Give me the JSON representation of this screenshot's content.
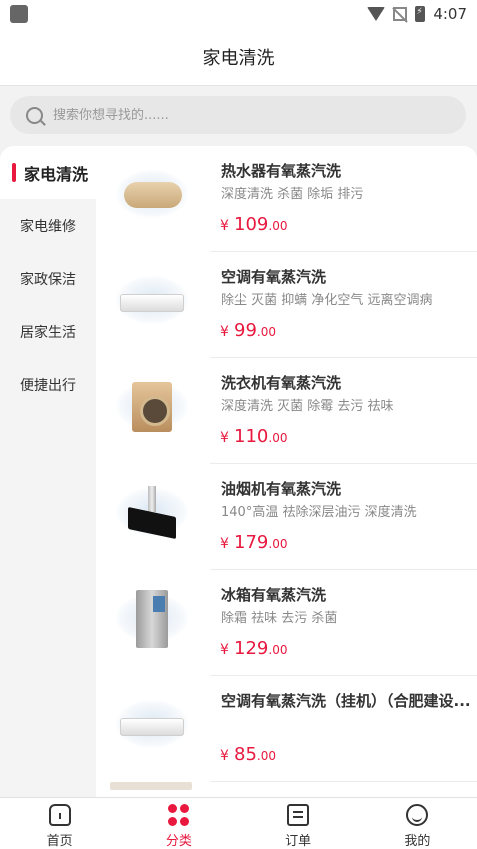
{
  "status_bar": {
    "time": "4:07"
  },
  "header": {
    "title": "家电清洗"
  },
  "search": {
    "placeholder": "搜索你想寻找的......"
  },
  "sidebar": {
    "items": [
      {
        "label": "家电清洗",
        "active": true
      },
      {
        "label": "家电维修",
        "active": false
      },
      {
        "label": "家政保洁",
        "active": false
      },
      {
        "label": "居家生活",
        "active": false
      },
      {
        "label": "便捷出行",
        "active": false
      }
    ]
  },
  "products": [
    {
      "title": "热水器有氧蒸汽洗",
      "subtitle": "深度清洗 杀菌 除垢 排污",
      "currency": "¥",
      "price_int": "109",
      "price_dec": ".00",
      "image": "water-heater"
    },
    {
      "title": "空调有氧蒸汽洗",
      "subtitle": "除尘 灭菌 抑螨 净化空气 远离空调病",
      "currency": "¥",
      "price_int": "99",
      "price_dec": ".00",
      "image": "air-conditioner"
    },
    {
      "title": "洗衣机有氧蒸汽洗",
      "subtitle": "深度清洗 灭菌 除霉 去污 祛味",
      "currency": "¥",
      "price_int": "110",
      "price_dec": ".00",
      "image": "washing-machine"
    },
    {
      "title": "油烟机有氧蒸汽洗",
      "subtitle": "140°高温 祛除深层油污 深度清洗",
      "currency": "¥",
      "price_int": "179",
      "price_dec": ".00",
      "image": "range-hood"
    },
    {
      "title": "冰箱有氧蒸汽洗",
      "subtitle": "除霜 祛味 去污 杀菌",
      "currency": "¥",
      "price_int": "129",
      "price_dec": ".00",
      "image": "refrigerator"
    },
    {
      "title": "空调有氧蒸汽洗（挂机）（合肥建设...",
      "subtitle": "",
      "currency": "¥",
      "price_int": "85",
      "price_dec": ".00",
      "image": "air-conditioner"
    }
  ],
  "tabbar": {
    "items": [
      {
        "label": "首页",
        "icon": "home-icon",
        "active": false
      },
      {
        "label": "分类",
        "icon": "category-icon",
        "active": true
      },
      {
        "label": "订单",
        "icon": "order-icon",
        "active": false
      },
      {
        "label": "我的",
        "icon": "profile-icon",
        "active": false
      }
    ]
  },
  "colors": {
    "accent": "#e8183e",
    "background": "#f2f2f2"
  }
}
